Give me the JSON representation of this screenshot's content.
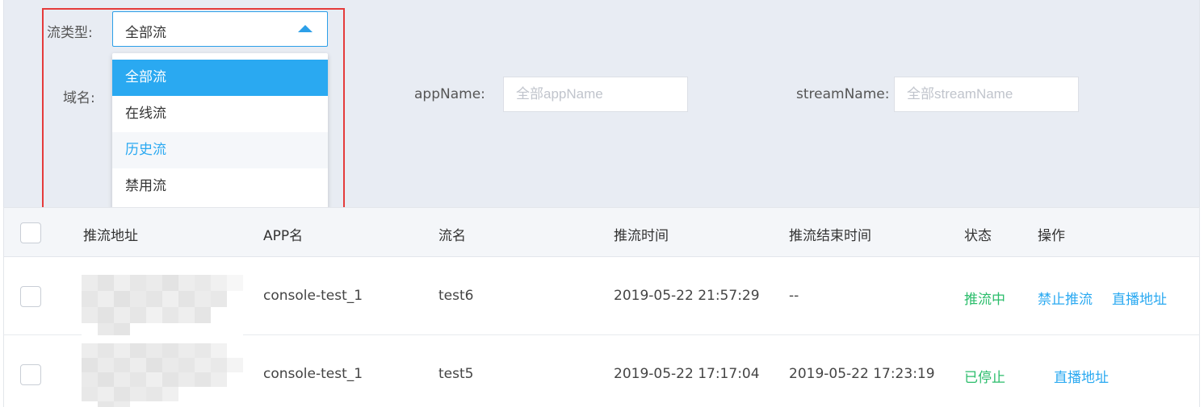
{
  "filters": {
    "stream_type_label": "流类型:",
    "stream_type_selected": "全部流",
    "stream_type_options": [
      "全部流",
      "在线流",
      "历史流",
      "禁用流"
    ],
    "domain_label": "域名:",
    "app_name_label": "appName:",
    "app_name_placeholder": "全部appName",
    "stream_name_label": "streamName:",
    "stream_name_placeholder": "全部streamName"
  },
  "table": {
    "headers": [
      "推流地址",
      "APP名",
      "流名",
      "推流时间",
      "推流结束时间",
      "状态",
      "操作"
    ],
    "rows": [
      {
        "app": "console-test_1",
        "stream": "test6",
        "start": "2019-05-22 21:57:29",
        "end": "--",
        "status": "推流中",
        "actions": [
          "禁止推流",
          "直播地址"
        ]
      },
      {
        "app": "console-test_1",
        "stream": "test5",
        "start": "2019-05-22 17:17:04",
        "end": "2019-05-22 17:23:19",
        "status": "已停止",
        "actions": [
          "直播地址"
        ]
      }
    ]
  },
  "colors": {
    "accent": "#2aa9f1",
    "status_green": "#2bbd6b",
    "highlight_red": "#e53b3b",
    "panel_bg": "#e8ecf3"
  }
}
